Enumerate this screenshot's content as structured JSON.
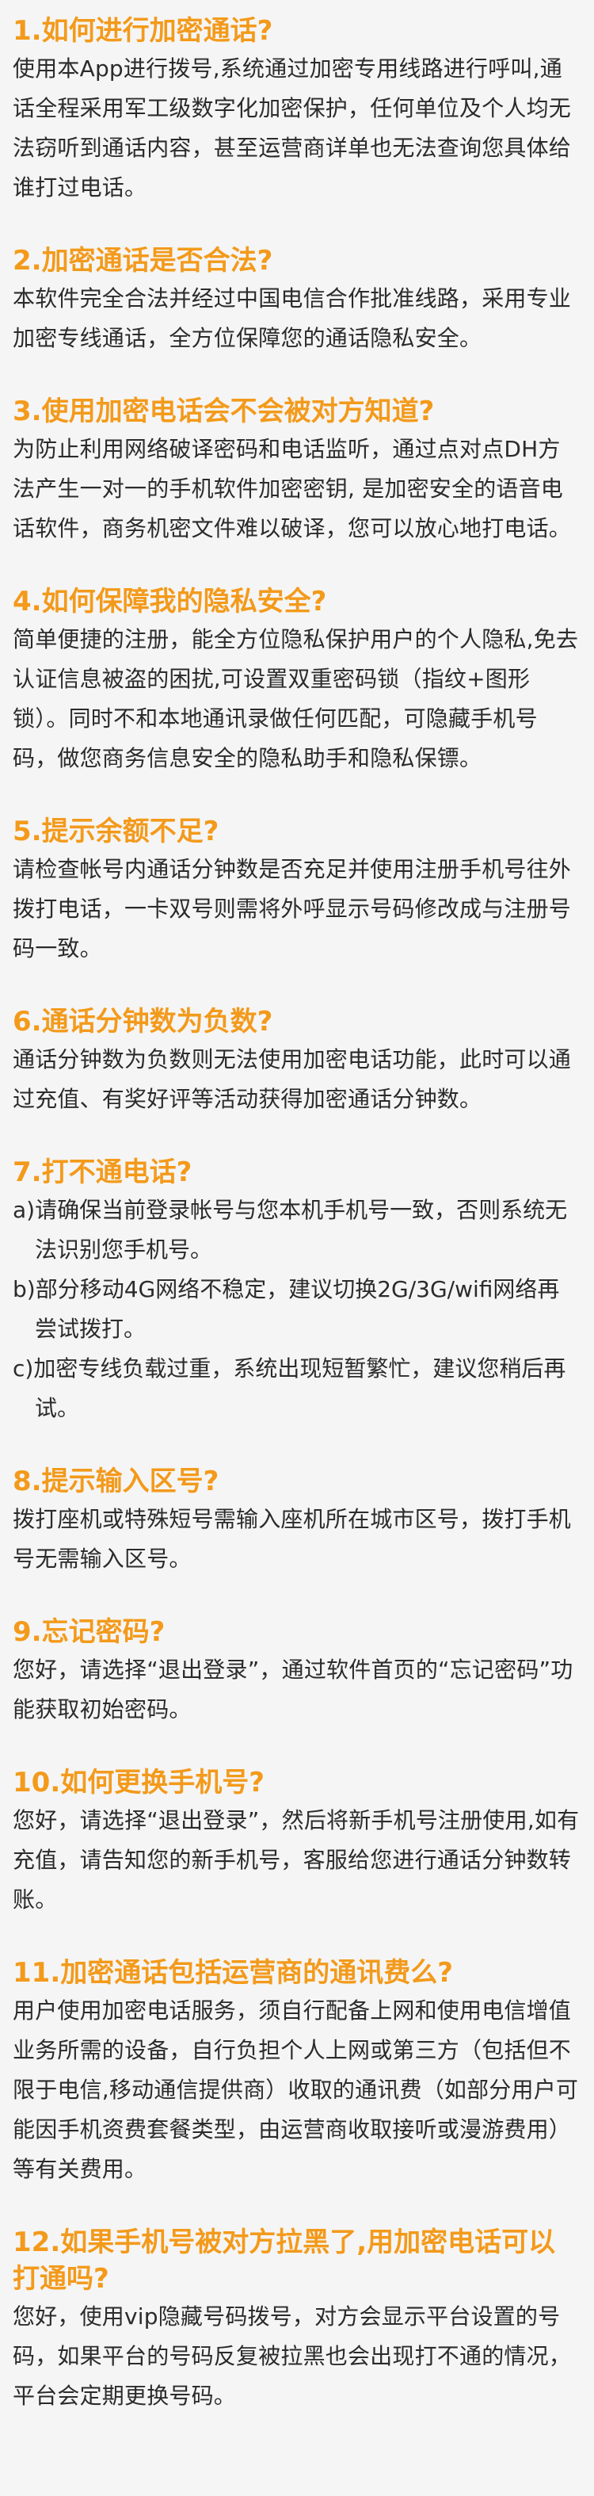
{
  "faq": [
    {
      "title": "1.如何进行加密通话?",
      "body": "使用本App进行拨号,系统通过加密专用线路进行呼叫,通话全程采用军工级数字化加密保护，任何单位及个人均无法窃听到通话内容，甚至运营商详单也无法查询您具体给谁打过电话。"
    },
    {
      "title": "2.加密通话是否合法?",
      "body": "本软件完全合法并经过中国电信合作批准线路，采用专业加密专线通话，全方位保障您的通话隐私安全。"
    },
    {
      "title": "3.使用加密电话会不会被对方知道?",
      "body": "为防止利用网络破译密码和电话监听，通过点对点DH方法产生一对一的手机软件加密密钥, 是加密安全的语音电话软件，商务机密文件难以破译，您可以放心地打电话。"
    },
    {
      "title": "4.如何保障我的隐私安全?",
      "body": "简单便捷的注册，能全方位隐私保护用户的个人隐私,免去认证信息被盗的困扰,可设置双重密码锁（指纹+图形锁）。同时不和本地通讯录做任何匹配，可隐藏手机号码，做您商务信息安全的隐私助手和隐私保镖。"
    },
    {
      "title": "5.提示余额不足?",
      "body": "请检查帐号内通话分钟数是否充足并使用注册手机号往外拨打电话，一卡双号则需将外呼显示号码修改成与注册号码一致。"
    },
    {
      "title": "6.通话分钟数为负数?",
      "body": "通话分钟数为负数则无法使用加密电话功能，此时可以通过充值、有奖好评等活动获得加密通话分钟数。"
    },
    {
      "title": "7.打不通电话?",
      "items": [
        "a)请确保当前登录帐号与您本机手机号一致，否则系统无法识别您手机号。",
        "b)部分移动4G网络不稳定，建议切换2G/3G/wifi网络再尝试拨打。",
        "c)加密专线负载过重，系统出现短暂繁忙，建议您稍后再试。"
      ]
    },
    {
      "title": "8.提示输入区号?",
      "body": "拨打座机或特殊短号需输入座机所在城市区号，拨打手机号无需输入区号。"
    },
    {
      "title": "9.忘记密码?",
      "body": "您好，请选择“退出登录”，通过软件首页的“忘记密码”功能获取初始密码。"
    },
    {
      "title": "10.如何更换手机号?",
      "body": "您好，请选择“退出登录”，然后将新手机号注册使用,如有充值，请告知您的新手机号，客服给您进行通话分钟数转账。"
    },
    {
      "title": "11.加密通话包括运营商的通讯费么?",
      "body": "用户使用加密电话服务，须自行配备上网和使用电信增值业务所需的设备，自行负担个人上网或第三方（包括但不限于电信,移动通信提供商）收取的通讯费（如部分用户可能因手机资费套餐类型，由运营商收取接听或漫游费用）等有关费用。"
    },
    {
      "title": "12.如果手机号被对方拉黑了,用加密电话可以打通吗?",
      "body": "您好，使用vip隐藏号码拨号，对方会显示平台设置的号码，如果平台的号码反复被拉黑也会出现打不通的情况，平台会定期更换号码。"
    }
  ]
}
